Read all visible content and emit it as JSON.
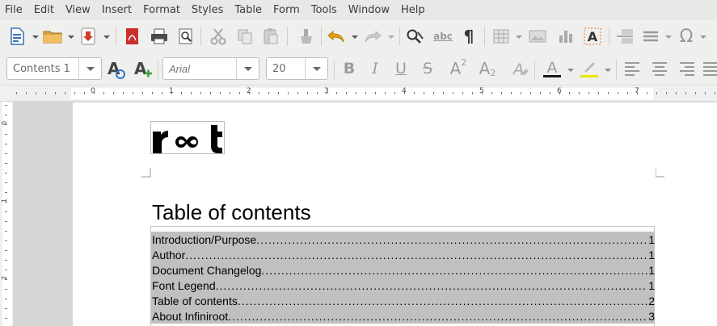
{
  "menubar": {
    "items": [
      "File",
      "Edit",
      "View",
      "Insert",
      "Format",
      "Styles",
      "Table",
      "Form",
      "Tools",
      "Window",
      "Help"
    ]
  },
  "toolbar1": {
    "icons": [
      "new-document-icon",
      "open-folder-icon",
      "save-icon",
      "export-pdf-icon",
      "print-icon",
      "print-preview-icon",
      "cut-icon",
      "copy-icon",
      "paste-icon",
      "clone-formatting-icon",
      "undo-icon",
      "redo-icon",
      "find-replace-icon",
      "spellcheck-icon",
      "formatting-marks-icon",
      "insert-table-icon",
      "insert-image-icon",
      "insert-chart-icon",
      "insert-textbox-icon",
      "insert-page-break-icon",
      "insert-field-icon",
      "special-character-icon"
    ],
    "spellcheck_text": "abc",
    "special_char_glyph": "Ω",
    "pilcrow_glyph": "¶"
  },
  "toolbar2": {
    "paragraph_style": "Contents 1",
    "font_name": "Arial",
    "font_size": "20",
    "bold": "B",
    "italic": "I",
    "underline": "U",
    "strike": "S",
    "superscript": "A",
    "superscript_exp": "2",
    "subscript": "A",
    "subscript_exp": "2",
    "font_color_glyph": "A"
  },
  "ruler": {
    "numbers": [
      "0",
      "1",
      "2",
      "3",
      "4",
      "5",
      "6",
      "7"
    ],
    "vnumbers": [
      "0",
      "1",
      "2"
    ]
  },
  "document": {
    "logo_text": "r∞t",
    "toc_title": "Table of contents",
    "toc_entries": [
      {
        "title": "Introduction/Purpose",
        "page": "1"
      },
      {
        "title": "Author",
        "page": "1"
      },
      {
        "title": "Document Changelog",
        "page": "1"
      },
      {
        "title": "Font Legend",
        "page": "1"
      },
      {
        "title": "Table of contents",
        "page": "2"
      },
      {
        "title": "About Infiniroot",
        "page": "3"
      }
    ]
  },
  "colors": {
    "toc_highlight": "#c0c0c0",
    "font_color_bar": "#1a1a1a",
    "highlight_bar": "#e6e600"
  }
}
